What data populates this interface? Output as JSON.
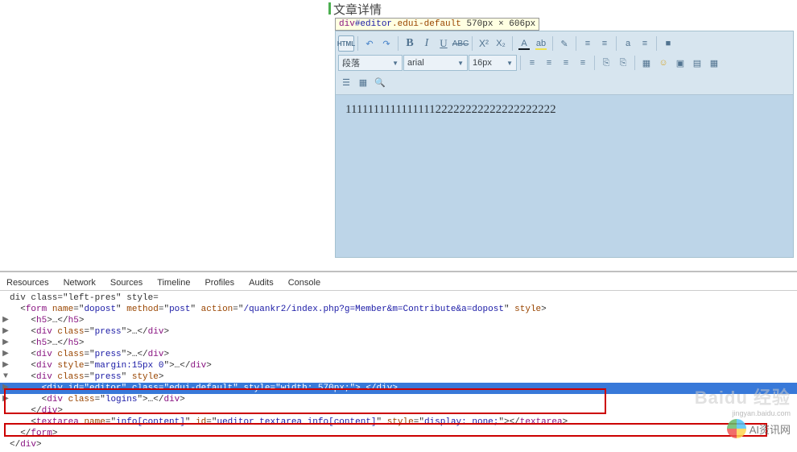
{
  "section_title": "文章详情",
  "inspector_tooltip": {
    "selector": "div",
    "id": "#editor",
    "cls": ".edui-default",
    "dims": " 570px × 606px"
  },
  "editor": {
    "content": "111111111111111122222222222222222222",
    "toolbar": {
      "html": "HTML",
      "undo": "↶",
      "redo": "↷",
      "bold": "B",
      "italic": "I",
      "underline": "U",
      "strike": "ABC",
      "sup": "X²",
      "sub": "X₂",
      "fontcolor": "A",
      "backcolor": "ab",
      "eraser": "✎",
      "ol": "≡",
      "ul": "≡",
      "indent1": "a",
      "indent2": "≡",
      "print": "■",
      "para_label": "段落",
      "font_label": "arial",
      "size_label": "16px",
      "align_l": "≡",
      "align_c": "≡",
      "align_r": "≡",
      "align_j": "≡",
      "link": "⎘",
      "unlink": "⎘",
      "img": "▦",
      "face": "☺",
      "video": "▣",
      "code": "▤",
      "table": "▦",
      "row2_b1": "☰",
      "row2_b2": "▦",
      "row2_b3": "🔍"
    }
  },
  "devtools": {
    "tabs": [
      "Resources",
      "Network",
      "Sources",
      "Timeline",
      "Profiles",
      "Audits",
      "Console"
    ],
    "lines": [
      {
        "arrow": "",
        "indent": 0,
        "html": {
          "pre": "   \" "
        },
        "partial": true,
        "parts": [
          {
            "t": "txt",
            "v": "div class=\"left-pres\" style="
          }
        ]
      },
      {
        "arrow": "",
        "indent": 1,
        "parts": [
          {
            "t": "txt",
            "v": "<"
          },
          {
            "t": "tag",
            "v": "form "
          },
          {
            "t": "attr",
            "v": "name"
          },
          {
            "t": "txt",
            "v": "=\""
          },
          {
            "t": "val",
            "v": "dopost"
          },
          {
            "t": "txt",
            "v": "\" "
          },
          {
            "t": "attr",
            "v": "method"
          },
          {
            "t": "txt",
            "v": "=\""
          },
          {
            "t": "val",
            "v": "post"
          },
          {
            "t": "txt",
            "v": "\" "
          },
          {
            "t": "attr",
            "v": "action"
          },
          {
            "t": "txt",
            "v": "=\""
          },
          {
            "t": "val",
            "v": "/quankr2/index.php?g=Member&m=Contribute&a=dopost"
          },
          {
            "t": "txt",
            "v": "\" "
          },
          {
            "t": "attr",
            "v": "style"
          },
          {
            "t": "txt",
            "v": ">"
          }
        ]
      },
      {
        "arrow": "▶",
        "indent": 2,
        "parts": [
          {
            "t": "txt",
            "v": "<"
          },
          {
            "t": "tag",
            "v": "h5"
          },
          {
            "t": "txt",
            "v": ">…</"
          },
          {
            "t": "tag",
            "v": "h5"
          },
          {
            "t": "txt",
            "v": ">"
          }
        ]
      },
      {
        "arrow": "▶",
        "indent": 2,
        "parts": [
          {
            "t": "txt",
            "v": "<"
          },
          {
            "t": "tag",
            "v": "div "
          },
          {
            "t": "attr",
            "v": "class"
          },
          {
            "t": "txt",
            "v": "=\""
          },
          {
            "t": "val",
            "v": "press"
          },
          {
            "t": "txt",
            "v": "\">…</"
          },
          {
            "t": "tag",
            "v": "div"
          },
          {
            "t": "txt",
            "v": ">"
          }
        ]
      },
      {
        "arrow": "▶",
        "indent": 2,
        "parts": [
          {
            "t": "txt",
            "v": "<"
          },
          {
            "t": "tag",
            "v": "h5"
          },
          {
            "t": "txt",
            "v": ">…</"
          },
          {
            "t": "tag",
            "v": "h5"
          },
          {
            "t": "txt",
            "v": ">"
          }
        ]
      },
      {
        "arrow": "▶",
        "indent": 2,
        "parts": [
          {
            "t": "txt",
            "v": "<"
          },
          {
            "t": "tag",
            "v": "div "
          },
          {
            "t": "attr",
            "v": "class"
          },
          {
            "t": "txt",
            "v": "=\""
          },
          {
            "t": "val",
            "v": "press"
          },
          {
            "t": "txt",
            "v": "\">…</"
          },
          {
            "t": "tag",
            "v": "div"
          },
          {
            "t": "txt",
            "v": ">"
          }
        ]
      },
      {
        "arrow": "▶",
        "indent": 2,
        "parts": [
          {
            "t": "txt",
            "v": "<"
          },
          {
            "t": "tag",
            "v": "div "
          },
          {
            "t": "attr",
            "v": "style"
          },
          {
            "t": "txt",
            "v": "=\""
          },
          {
            "t": "val",
            "v": "margin:15px 0"
          },
          {
            "t": "txt",
            "v": "\">…</"
          },
          {
            "t": "tag",
            "v": "div"
          },
          {
            "t": "txt",
            "v": ">"
          }
        ]
      },
      {
        "arrow": "▼",
        "indent": 2,
        "parts": [
          {
            "t": "txt",
            "v": "<"
          },
          {
            "t": "tag",
            "v": "div "
          },
          {
            "t": "attr",
            "v": "class"
          },
          {
            "t": "txt",
            "v": "=\""
          },
          {
            "t": "val",
            "v": "press"
          },
          {
            "t": "txt",
            "v": "\" "
          },
          {
            "t": "attr",
            "v": "style"
          },
          {
            "t": "txt",
            "v": ">"
          }
        ]
      },
      {
        "arrow": "▶",
        "indent": 3,
        "selected": true,
        "parts": [
          {
            "t": "txt",
            "v": "<"
          },
          {
            "t": "tag",
            "v": "div "
          },
          {
            "t": "attr",
            "v": "id"
          },
          {
            "t": "txt",
            "v": "=\""
          },
          {
            "t": "val",
            "v": "editor"
          },
          {
            "t": "txt",
            "v": "\" "
          },
          {
            "t": "attr",
            "v": "class"
          },
          {
            "t": "txt",
            "v": "=\""
          },
          {
            "t": "val",
            "v": "edui-default"
          },
          {
            "t": "txt",
            "v": "\" "
          },
          {
            "t": "attr",
            "v": "style"
          },
          {
            "t": "txt",
            "v": "=\""
          },
          {
            "t": "val",
            "v": "width: 570px;"
          },
          {
            "t": "txt",
            "v": "\">…</"
          },
          {
            "t": "tag",
            "v": "div"
          },
          {
            "t": "txt",
            "v": ">"
          }
        ]
      },
      {
        "arrow": "▶",
        "indent": 3,
        "parts": [
          {
            "t": "txt",
            "v": "<"
          },
          {
            "t": "tag",
            "v": "div "
          },
          {
            "t": "attr",
            "v": "class"
          },
          {
            "t": "txt",
            "v": "=\""
          },
          {
            "t": "val",
            "v": "logins"
          },
          {
            "t": "txt",
            "v": "\">…</"
          },
          {
            "t": "tag",
            "v": "div"
          },
          {
            "t": "txt",
            "v": ">"
          }
        ]
      },
      {
        "arrow": "",
        "indent": 2,
        "parts": [
          {
            "t": "txt",
            "v": "</"
          },
          {
            "t": "tag",
            "v": "div"
          },
          {
            "t": "txt",
            "v": ">"
          }
        ]
      },
      {
        "arrow": "",
        "indent": 2,
        "parts": [
          {
            "t": "txt",
            "v": "<"
          },
          {
            "t": "tag",
            "v": "textarea "
          },
          {
            "t": "attr",
            "v": "name"
          },
          {
            "t": "txt",
            "v": "=\""
          },
          {
            "t": "val",
            "v": "info[content]"
          },
          {
            "t": "txt",
            "v": "\" "
          },
          {
            "t": "attr",
            "v": "id"
          },
          {
            "t": "txt",
            "v": "=\""
          },
          {
            "t": "val",
            "v": "ueditor_textarea_info[content]"
          },
          {
            "t": "txt",
            "v": "\" "
          },
          {
            "t": "attr",
            "v": "style"
          },
          {
            "t": "txt",
            "v": "=\""
          },
          {
            "t": "val",
            "v": "display: none;"
          },
          {
            "t": "txt",
            "v": "\"></"
          },
          {
            "t": "tag",
            "v": "textarea"
          },
          {
            "t": "txt",
            "v": ">"
          }
        ]
      },
      {
        "arrow": "",
        "indent": 1,
        "parts": [
          {
            "t": "txt",
            "v": "</"
          },
          {
            "t": "tag",
            "v": "form"
          },
          {
            "t": "txt",
            "v": ">"
          }
        ]
      },
      {
        "arrow": "",
        "indent": 0,
        "parts": [
          {
            "t": "txt",
            "v": "</"
          },
          {
            "t": "tag",
            "v": "div"
          },
          {
            "t": "txt",
            "v": ">"
          }
        ]
      }
    ]
  },
  "watermark": {
    "baidu": "Baidu 经验",
    "sub": "jingyan.baidu.com",
    "ai": "AI资讯网"
  }
}
